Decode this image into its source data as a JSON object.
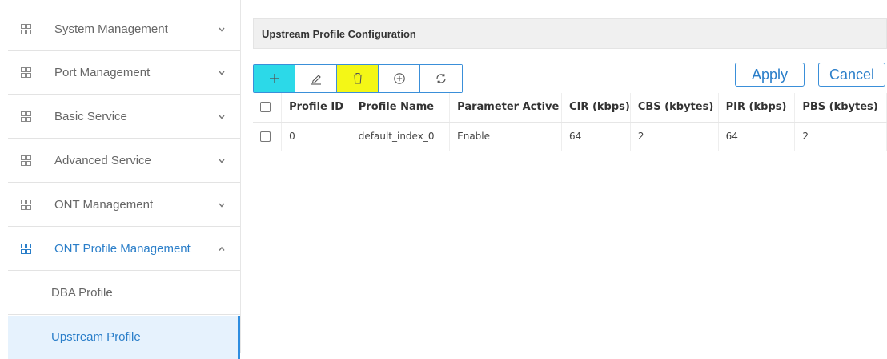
{
  "sidebar": {
    "items": [
      {
        "label": "System Management",
        "icon": "grid-icon",
        "chevron": "chevron-down"
      },
      {
        "label": "Port Management",
        "icon": "grid-icon",
        "chevron": "chevron-down"
      },
      {
        "label": "Basic Service",
        "icon": "grid-icon",
        "chevron": "chevron-down"
      },
      {
        "label": "Advanced Service",
        "icon": "grid-icon",
        "chevron": "chevron-down"
      },
      {
        "label": "ONT Management",
        "icon": "grid-icon",
        "chevron": "chevron-down"
      },
      {
        "label": "ONT Profile Management",
        "icon": "grid-icon",
        "chevron": "chevron-up",
        "expanded": true
      }
    ],
    "sub_items": [
      {
        "label": "DBA Profile",
        "selected": false
      },
      {
        "label": "Upstream Profile",
        "selected": true
      }
    ],
    "accent_color": "#2a7ec9"
  },
  "panel": {
    "title": "Upstream Profile Configuration"
  },
  "toolbar": {
    "buttons": [
      {
        "name": "add",
        "icon": "plus-icon",
        "highlight": "#2cd9e8"
      },
      {
        "name": "edit",
        "icon": "pencil-icon"
      },
      {
        "name": "delete",
        "icon": "trash-icon",
        "highlight": "#f4f716"
      },
      {
        "name": "add-circle",
        "icon": "plus-circle-icon"
      },
      {
        "name": "refresh",
        "icon": "refresh-icon"
      }
    ],
    "apply_label": "Apply",
    "cancel_label": "Cancel"
  },
  "table": {
    "columns": [
      "Profile ID",
      "Profile Name",
      "Parameter Active",
      "CIR (kbps)",
      "CBS (kbytes)",
      "PIR (kbps)",
      "PBS (kbytes)"
    ],
    "rows": [
      [
        "0",
        "default_index_0",
        "Enable",
        "64",
        "2",
        "64",
        "2"
      ]
    ]
  }
}
